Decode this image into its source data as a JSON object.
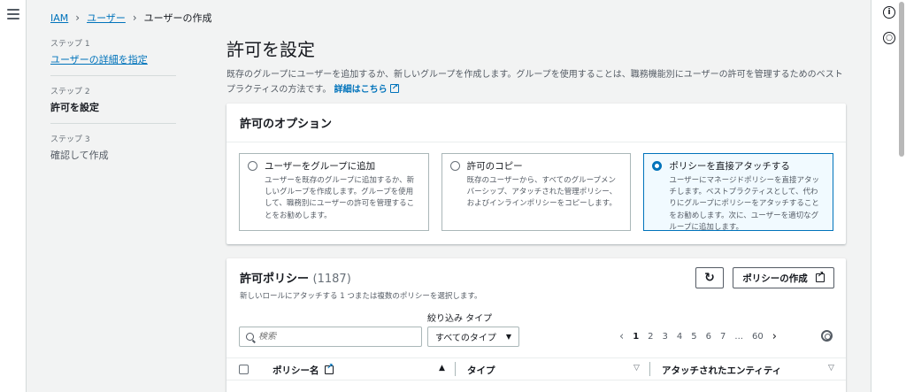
{
  "breadcrumb": {
    "root": "IAM",
    "parent": "ユーザー",
    "current": "ユーザーの作成"
  },
  "steps": [
    {
      "num": "ステップ 1",
      "label": "ユーザーの詳細を指定"
    },
    {
      "num": "ステップ 2",
      "label": "許可を設定"
    },
    {
      "num": "ステップ 3",
      "label": "確認して作成"
    }
  ],
  "page": {
    "title": "許可を設定",
    "description": "既存のグループにユーザーを追加するか、新しいグループを作成します。グループを使用することは、職務機能別にユーザーの許可を管理するためのベストプラクティスの方法です。",
    "learn_more": "詳細はこちら"
  },
  "options_card": {
    "title": "許可のオプション",
    "options": [
      {
        "title": "ユーザーをグループに追加",
        "desc": "ユーザーを既存のグループに追加するか、新しいグループを作成します。グループを使用して、職務別にユーザーの許可を管理することをお勧めします。",
        "selected": false
      },
      {
        "title": "許可のコピー",
        "desc": "既存のユーザーから、すべてのグループメンバーシップ、アタッチされた管理ポリシー、およびインラインポリシーをコピーします。",
        "selected": false
      },
      {
        "title": "ポリシーを直接アタッチする",
        "desc": "ユーザーにマネージドポリシーを直接アタッチします。ベストプラクティスとして、代わりにグループにポリシーをアタッチすることをお勧めします。次に、ユーザーを適切なグループに追加します。",
        "selected": true
      }
    ]
  },
  "policies": {
    "title": "許可ポリシー",
    "count": "(1187)",
    "description": "新しいロールにアタッチする 1 つまたは複数のポリシーを選択します。",
    "create_button": "ポリシーの作成",
    "filter_label": "絞り込み タイプ",
    "search_placeholder": "検索",
    "type_select": "すべてのタイプ",
    "pages": [
      "1",
      "2",
      "3",
      "4",
      "5",
      "6",
      "7",
      "...",
      "60"
    ],
    "columns": {
      "name": "ポリシー名",
      "type": "タイプ",
      "entities": "アタッチされたエンティティ"
    }
  },
  "colors": {
    "accent": "#0073bb",
    "text": "#16191f",
    "muted": "#545b64"
  }
}
